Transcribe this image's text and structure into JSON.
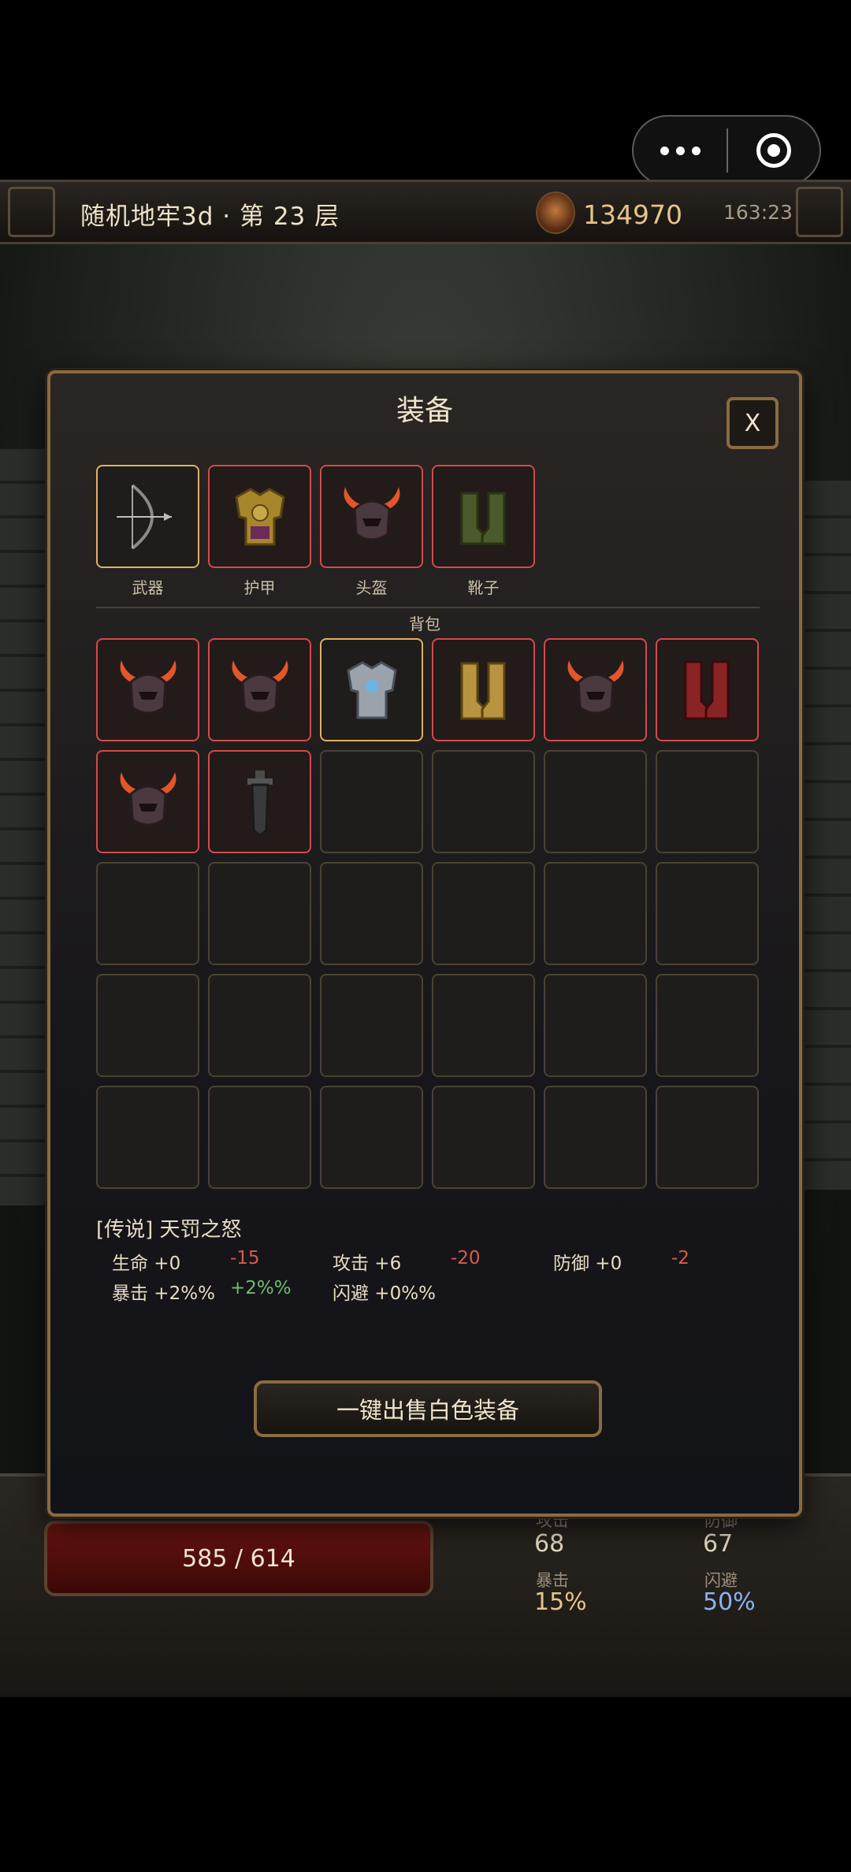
{
  "header": {
    "title": "随机地牢3d · 第 23 层",
    "gold": "134970",
    "clock": "163:23"
  },
  "modal": {
    "title": "装备",
    "close_label": "X",
    "equipped": [
      {
        "label": "武器",
        "icon": "bow-icon",
        "rarity": "gold"
      },
      {
        "label": "护甲",
        "icon": "gold-armor-icon",
        "rarity": "red"
      },
      {
        "label": "头盔",
        "icon": "horned-helmet-icon",
        "rarity": "red"
      },
      {
        "label": "靴子",
        "icon": "green-boots-icon",
        "rarity": "red"
      }
    ],
    "bag_label": "背包",
    "bag_items": [
      {
        "icon": "horned-helmet-icon",
        "rarity": "red"
      },
      {
        "icon": "horned-helmet-icon",
        "rarity": "red"
      },
      {
        "icon": "silver-armor-icon",
        "rarity": "gold"
      },
      {
        "icon": "gold-boots-icon",
        "rarity": "red"
      },
      {
        "icon": "horned-helmet-icon",
        "rarity": "red"
      },
      {
        "icon": "red-boots-icon",
        "rarity": "red"
      },
      {
        "icon": "horned-helmet-icon",
        "rarity": "red"
      },
      {
        "icon": "dark-sword-icon",
        "rarity": "red"
      }
    ],
    "empty_slots": 22,
    "item_detail": {
      "title": "[传说] 天罚之怒",
      "hp": "生命 +0",
      "hp_diff": "-15",
      "atk": "攻击 +6",
      "atk_diff": "-20",
      "def": "防御 +0",
      "def_diff": "-2",
      "crit": "暴击 +2%%",
      "crit_diff": "+2%%",
      "dodge": "闪避 +0%%"
    },
    "sell_label": "一键出售白色装备"
  },
  "hud": {
    "hp": "585 / 614",
    "atk_label": "攻击",
    "atk": "68",
    "def_label": "防御",
    "def": "67",
    "crit_label": "暴击",
    "crit": "15%",
    "dodge_label": "闪避",
    "dodge": "50%"
  },
  "colors": {
    "rare_border": "#d44a4a",
    "gold_border": "#e0b060",
    "crit": "#e6c48a",
    "dodge": "#8ab4f0"
  }
}
